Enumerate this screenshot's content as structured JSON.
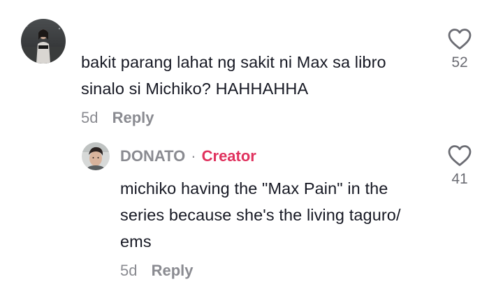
{
  "comment": {
    "text_lines": [
      "bakit parang lahat ng sakit ni Max sa libro",
      "sinalo si Michiko? HAHHAHHA"
    ],
    "age": "5d",
    "reply_label": "Reply",
    "like_count": "52",
    "like_icon": "heart-outline-icon"
  },
  "reply": {
    "username": "DONATO",
    "separator": "·",
    "badge": "Creator",
    "badge_color": "#e0325e",
    "text_lines": [
      "michiko having the \"Max Pain\" in the",
      "series because she's the living taguro/",
      "ems"
    ],
    "age": "5d",
    "reply_label": "Reply",
    "like_count": "41",
    "like_icon": "heart-outline-icon"
  }
}
